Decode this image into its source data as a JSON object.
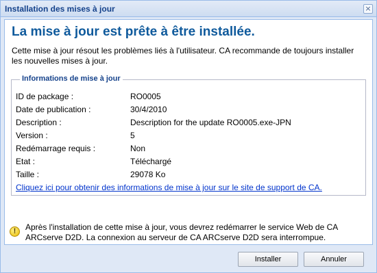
{
  "window": {
    "title": "Installation des mises à jour",
    "close_symbol": "×"
  },
  "content": {
    "heading": "La mise à jour est prête à être installée.",
    "intro": "Cette mise à jour résout les problèmes liés à l'utilisateur. CA recommande de toujours installer les nouvelles mises à jour."
  },
  "info": {
    "legend": "Informations de mise à jour",
    "rows": [
      {
        "label": "ID de package :",
        "value": "RO0005"
      },
      {
        "label": "Date de publication :",
        "value": "30/4/2010"
      },
      {
        "label": "Description :",
        "value": "Description for the update RO0005.exe-JPN"
      },
      {
        "label": "Version :",
        "value": "5"
      },
      {
        "label": "Redémarrage requis :",
        "value": "Non"
      },
      {
        "label": "Etat :",
        "value": "Téléchargé"
      },
      {
        "label": "Taille :",
        "value": "29078 Ko"
      }
    ],
    "link": "Cliquez ici pour obtenir des informations de mise à jour sur le site de support de CA."
  },
  "warning": {
    "icon": "warning-icon",
    "icon_glyph": "!",
    "text": "Après l'installation de cette mise à jour, vous devrez redémarrer le service Web de CA ARCserve D2D. La connexion au serveur de CA ARCserve D2D sera interrompue."
  },
  "buttons": {
    "install": "Installer",
    "cancel": "Annuler"
  }
}
